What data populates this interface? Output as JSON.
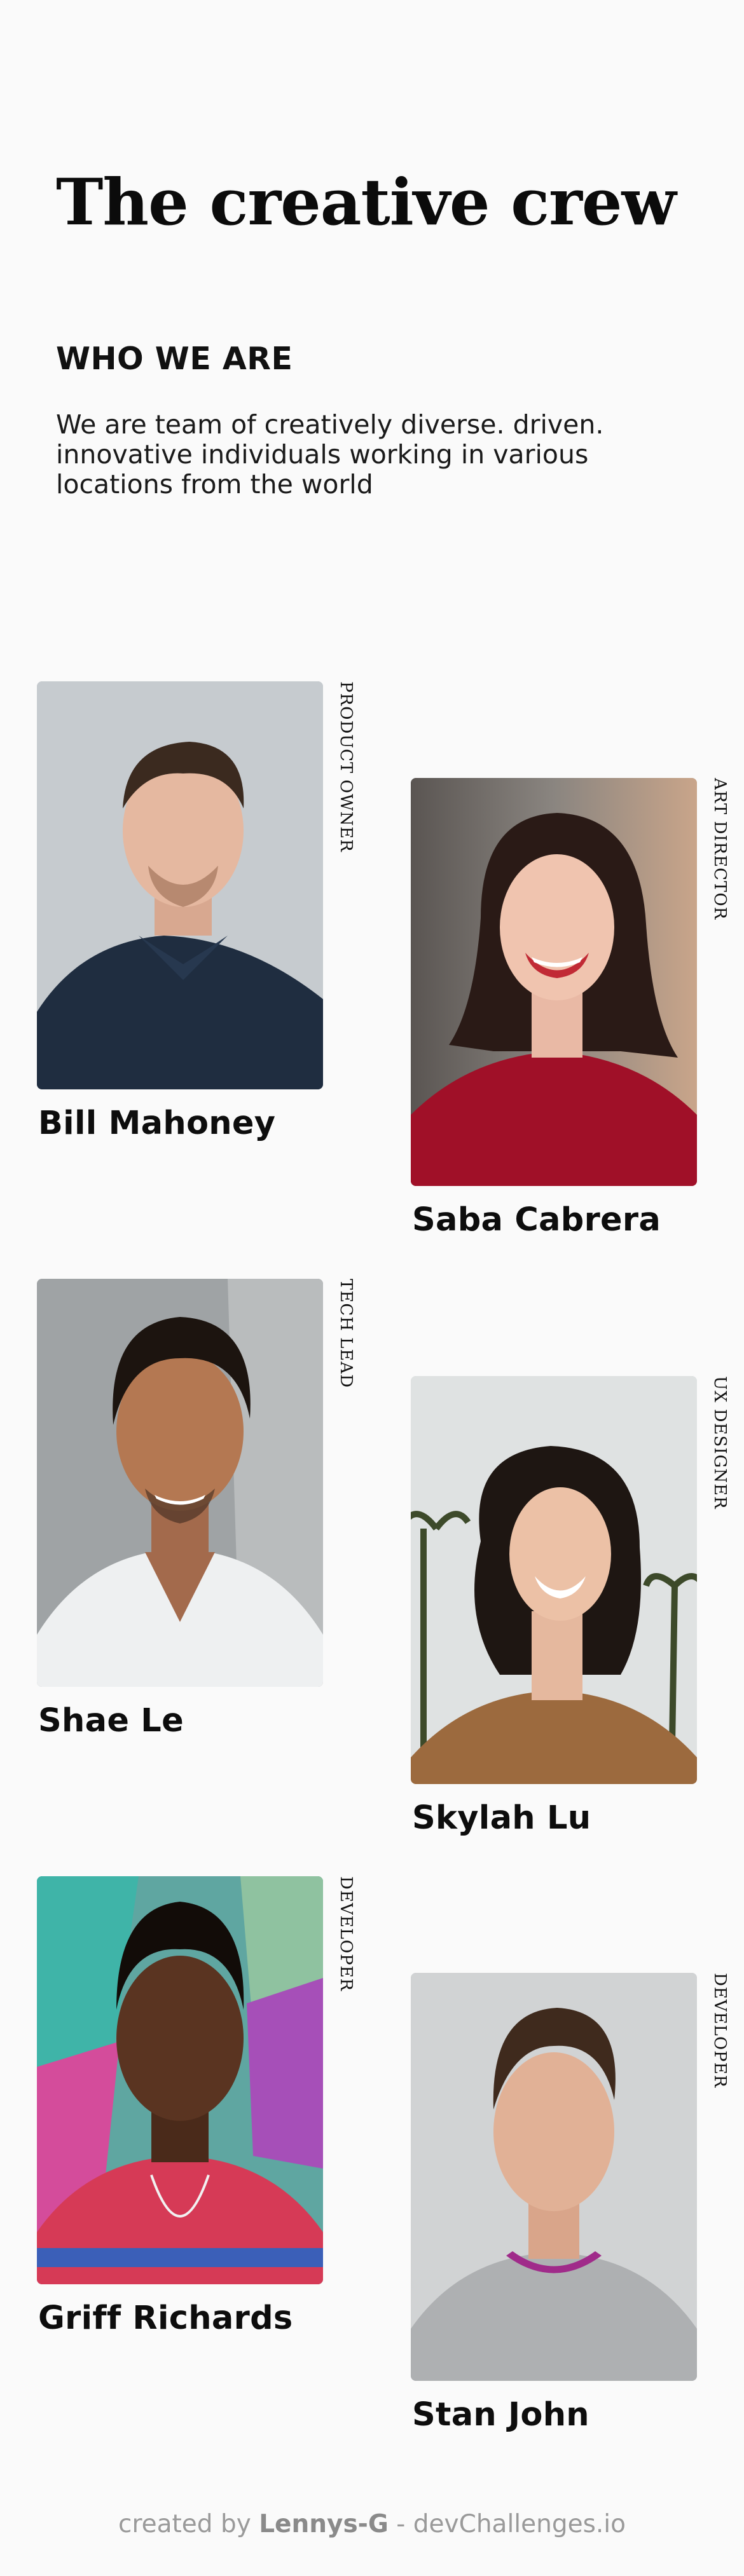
{
  "page_title": "The creative crew",
  "about": {
    "heading": "WHO WE ARE",
    "text": "We are team of creatively diverse. driven. innovative individuals working in various locations from the world"
  },
  "members": [
    {
      "name": "Bill Mahoney",
      "role": "PRODUCT OWNER",
      "photo_alt": "portrait-man-navy-polo"
    },
    {
      "name": "Saba Cabrera",
      "role": "ART DIRECTOR",
      "photo_alt": "portrait-woman-red-sweater"
    },
    {
      "name": "Shae Le",
      "role": "TECH LEAD",
      "photo_alt": "portrait-man-white-tshirt"
    },
    {
      "name": "Skylah Lu",
      "role": "UX DESIGNER",
      "photo_alt": "portrait-woman-palm-trees"
    },
    {
      "name": "Griff Richards",
      "role": "DEVELOPER",
      "photo_alt": "portrait-man-graffiti-wall"
    },
    {
      "name": "Stan John",
      "role": "DEVELOPER",
      "photo_alt": "portrait-man-grey-sweater"
    }
  ],
  "footer": {
    "prefix": "created by",
    "author": "Lennys-G",
    "separator": "-",
    "site": "devChallenges.io"
  }
}
